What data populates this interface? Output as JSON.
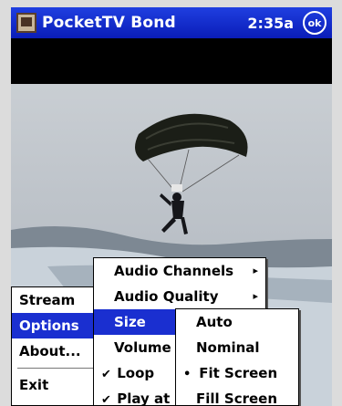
{
  "titlebar": {
    "app_title": "PocketTV Bond",
    "clock": "2:35a",
    "ok_label": "ok"
  },
  "main_menu": {
    "items": [
      {
        "label": "Stream"
      },
      {
        "label": "Options",
        "highlighted": true
      },
      {
        "label": "About..."
      },
      {
        "label": "Exit"
      }
    ]
  },
  "options_menu": {
    "items": [
      {
        "label": "Audio Channels",
        "submenu": true
      },
      {
        "label": "Audio Quality",
        "submenu": true
      },
      {
        "label": "Size",
        "submenu": true,
        "highlighted": true
      },
      {
        "label": "Volume"
      },
      {
        "label": "Loop",
        "checked": true
      },
      {
        "label": "Play at",
        "checked": true
      }
    ]
  },
  "size_menu": {
    "items": [
      {
        "label": "Auto"
      },
      {
        "label": "Nominal"
      },
      {
        "label": "Fit Screen",
        "selected": true
      },
      {
        "label": "Fill Screen"
      }
    ]
  },
  "glyphs": {
    "submenu_arrow": "▸",
    "check": "✔",
    "bullet": "•"
  },
  "colors": {
    "titlebar": "#0a1db8",
    "highlight": "#1a2fd0"
  }
}
